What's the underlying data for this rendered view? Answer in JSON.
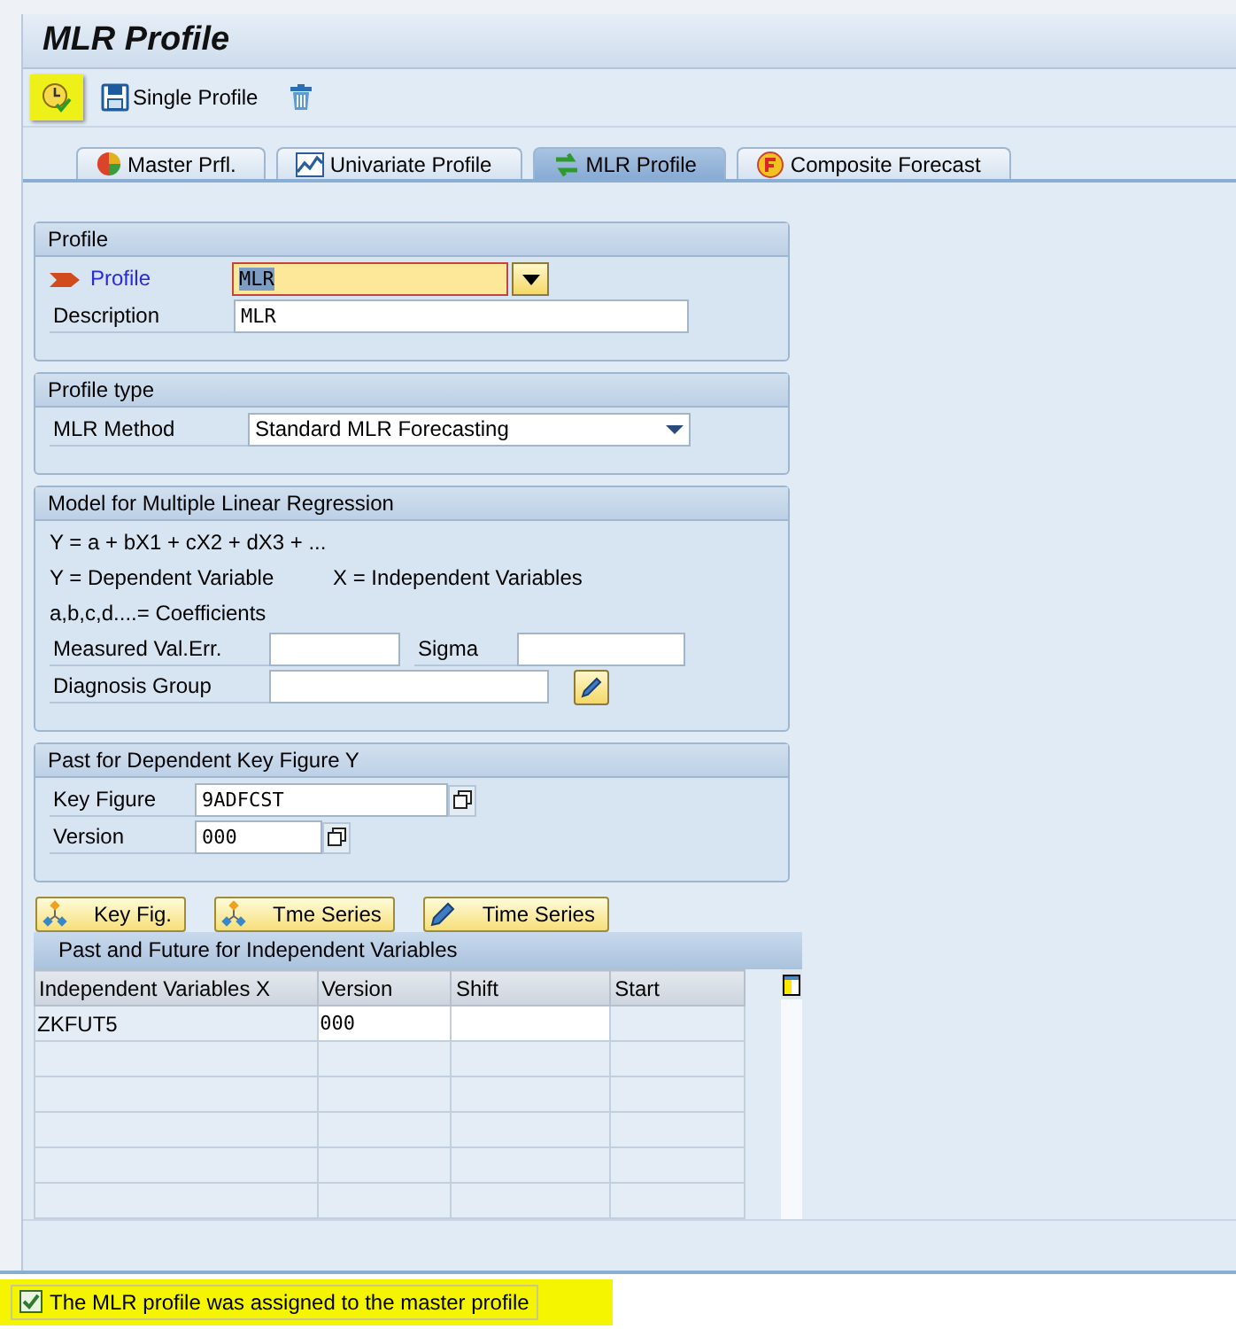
{
  "window": {
    "title": "MLR Profile"
  },
  "toolbar": [
    {
      "kind": "execute",
      "highlighted": true
    },
    {
      "kind": "save",
      "label": "Single Profile",
      "highlighted": false
    },
    {
      "kind": "delete",
      "highlighted": false
    }
  ],
  "tabs": [
    {
      "kind": "master",
      "label": "Master Prfl.",
      "selected": false
    },
    {
      "kind": "univariate",
      "label": "Univariate Profile",
      "selected": false
    },
    {
      "kind": "mlr",
      "label": "MLR Profile",
      "selected": true
    },
    {
      "kind": "composite",
      "label": "Composite Forecast",
      "selected": false
    }
  ],
  "profile_group": {
    "title": "Profile",
    "profile_label": "Profile",
    "profile_value": "MLR",
    "description_label": "Description",
    "description_value": "MLR"
  },
  "profile_type_group": {
    "title": "Profile type",
    "method_label": "MLR Method",
    "method_value": "Standard MLR Forecasting"
  },
  "model_group": {
    "title": "Model for Multiple Linear Regression",
    "formula": "Y = a + bX1 + cX2 + dX3 + ...",
    "dependent_note": "Y = Dependent Variable",
    "independent_note": "X = Independent Variables",
    "coefficients_note": "a,b,c,d....= Coefficients",
    "measured_label": "Measured Val.Err.",
    "sigma_label": "Sigma",
    "diagnosis_label": "Diagnosis Group"
  },
  "past_group": {
    "title": "Past for Dependent Key Figure Y",
    "key_figure_label": "Key Figure",
    "key_figure_value": "9ADFCST",
    "version_label": "Version",
    "version_value": "000"
  },
  "action_buttons": [
    {
      "kind": "hierarchy",
      "label": "Key Fig."
    },
    {
      "kind": "hierarchy",
      "label": "Tme Series"
    },
    {
      "kind": "pencil",
      "label": "Time Series"
    }
  ],
  "table": {
    "title": "Past and Future for Independent Variables",
    "columns": [
      "Independent Variables X",
      "Version",
      "Shift",
      "Start"
    ],
    "rows": [
      {
        "variable": "ZKFUT5",
        "version": "000"
      }
    ]
  },
  "status_bar": {
    "kind": "success",
    "message": "The MLR profile was assigned to the master profile",
    "highlighted": true
  }
}
